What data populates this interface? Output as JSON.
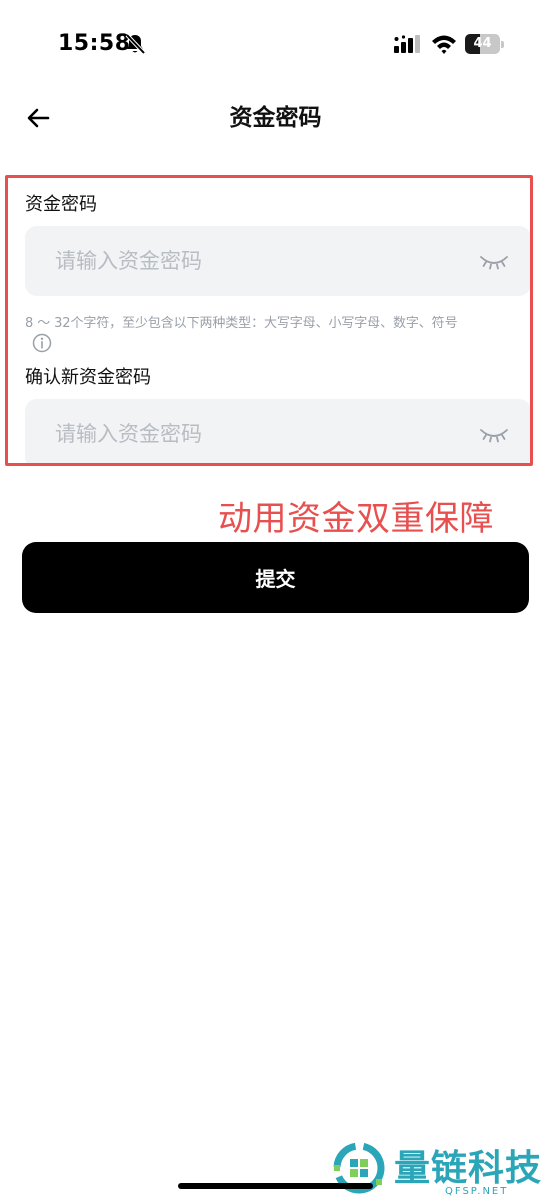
{
  "status_bar": {
    "time": "15:58",
    "battery_level": "44",
    "battery_fraction": 0.44,
    "icons": [
      "bell-off-icon",
      "signal-icon",
      "wifi-icon",
      "battery-icon"
    ]
  },
  "header": {
    "title": "资金密码",
    "back_icon": "arrow-left-icon"
  },
  "form": {
    "password_label": "资金密码",
    "password_placeholder": "请输入资金密码",
    "password_value": "",
    "hint": "8 ～ 32个字符，至少包含以下两种类型：大写字母、小写字母、数字、符号",
    "confirm_label": "确认新资金密码",
    "confirm_placeholder": "请输入资金密码",
    "confirm_value": "",
    "eye_icon": "eye-closed-icon",
    "info_icon": "info-icon"
  },
  "annotation": {
    "text": "动用资金双重保障",
    "color": "#e84f4f"
  },
  "submit": {
    "label": "提交"
  },
  "watermark": {
    "name": "量链科技",
    "url": "QFSP.NET",
    "color": "#2aa6b8"
  }
}
